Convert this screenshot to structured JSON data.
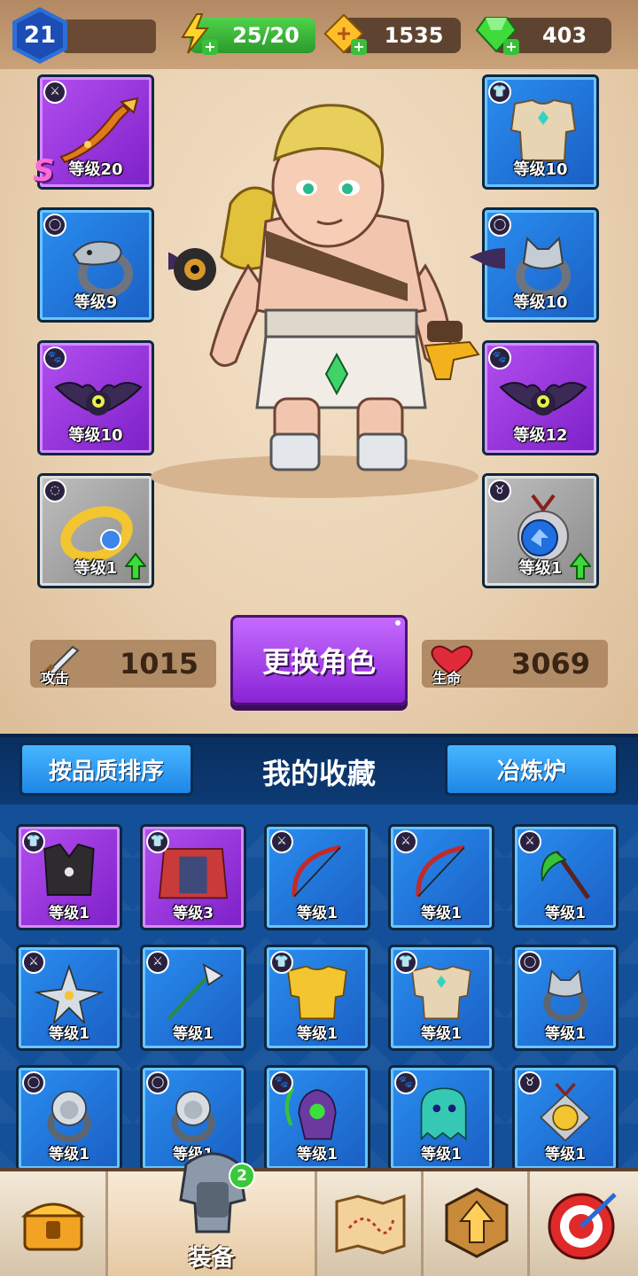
{
  "player": {
    "level": "21"
  },
  "resources": {
    "energy": "25/20",
    "ticket": "1535",
    "gems": "403"
  },
  "hero_slots": {
    "left": [
      {
        "type": "weapon-icon",
        "level": "等级20",
        "grade": "S",
        "rarity": "purple"
      },
      {
        "type": "ring-icon",
        "level": "等级9",
        "rarity": "blue"
      },
      {
        "type": "pet-icon",
        "level": "等级10",
        "rarity": "purple"
      },
      {
        "type": "bracelet-icon",
        "level": "等级1",
        "rarity": "gray",
        "upgrade": true
      }
    ],
    "right": [
      {
        "type": "armor-icon",
        "level": "等级10",
        "rarity": "blue"
      },
      {
        "type": "ring-icon",
        "level": "等级10",
        "rarity": "blue"
      },
      {
        "type": "pet-icon",
        "level": "等级12",
        "rarity": "purple"
      },
      {
        "type": "amulet-icon",
        "level": "等级1",
        "rarity": "gray",
        "upgrade": true
      }
    ]
  },
  "stats": {
    "attack_label": "攻击",
    "attack_value": "1015",
    "hp_label": "生命",
    "hp_value": "3069"
  },
  "change_hero_button": "更换角色",
  "collection": {
    "sort_button": "按品质排序",
    "title": "我的收藏",
    "smelter_button": "冶炼炉",
    "items": [
      {
        "type": "armor-icon",
        "art": "vest",
        "level": "等级1",
        "rarity": "purple"
      },
      {
        "type": "armor-icon",
        "art": "cloak",
        "level": "等级3",
        "rarity": "purple"
      },
      {
        "type": "weapon-icon",
        "art": "bow",
        "level": "等级1",
        "rarity": "blue"
      },
      {
        "type": "weapon-icon",
        "art": "bow",
        "level": "等级1",
        "rarity": "blue"
      },
      {
        "type": "weapon-icon",
        "art": "scythe",
        "level": "等级1",
        "rarity": "blue"
      },
      {
        "type": "weapon-icon",
        "art": "shuriken",
        "level": "等级1",
        "rarity": "blue"
      },
      {
        "type": "weapon-icon",
        "art": "spear",
        "level": "等级1",
        "rarity": "blue"
      },
      {
        "type": "armor-icon",
        "art": "gold-armor",
        "level": "等级1",
        "rarity": "blue"
      },
      {
        "type": "armor-icon",
        "art": "plate-armor",
        "level": "等级1",
        "rarity": "blue"
      },
      {
        "type": "ring-icon",
        "art": "wolf-ring",
        "level": "等级1",
        "rarity": "blue"
      },
      {
        "type": "ring-icon",
        "art": "lion-ring",
        "level": "等级1",
        "rarity": "blue"
      },
      {
        "type": "ring-icon",
        "art": "lion-ring",
        "level": "等级1",
        "rarity": "blue"
      },
      {
        "type": "pet-icon",
        "art": "reaper",
        "level": "等级1",
        "rarity": "blue"
      },
      {
        "type": "pet-icon",
        "art": "ghost",
        "level": "等级1",
        "rarity": "blue"
      },
      {
        "type": "amulet-icon",
        "art": "lion-amulet",
        "level": "等级1",
        "rarity": "blue"
      }
    ]
  },
  "nav": {
    "items": [
      {
        "name": "treasure-chest"
      },
      {
        "name": "equipment",
        "label": "装备",
        "badge": "2"
      },
      {
        "name": "map"
      },
      {
        "name": "upgrade"
      },
      {
        "name": "target"
      }
    ]
  },
  "colors": {
    "purple": "#9b3de0",
    "blue": "#1f76dc",
    "gray": "#a3a3a3",
    "panel_bg": "#145099"
  }
}
